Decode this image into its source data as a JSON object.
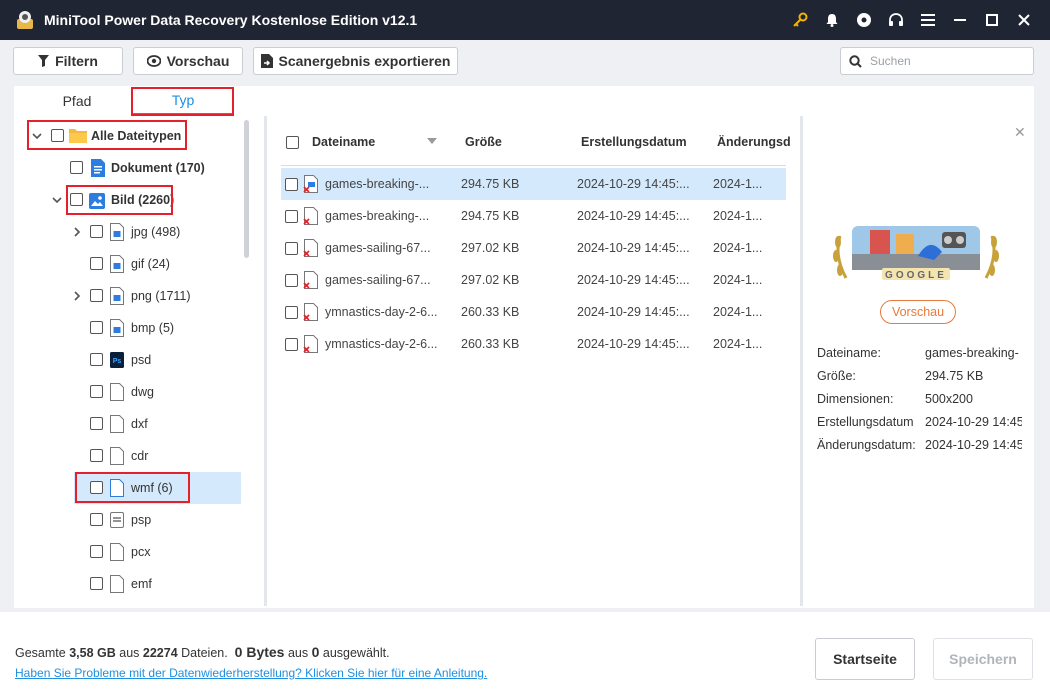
{
  "window": {
    "title": "MiniTool Power Data Recovery Kostenlose Edition v12.1"
  },
  "toolbar": {
    "filter_label": "Filtern",
    "preview_label": "Vorschau",
    "export_label": "Scanergebnis exportieren",
    "search_placeholder": "Suchen"
  },
  "tabs": {
    "path_label": "Pfad",
    "type_label": "Typ"
  },
  "tree": {
    "root_label": "Alle Dateitypen",
    "document_label": "Dokument (170)",
    "image_label": "Bild (2260)",
    "items": [
      {
        "label": "jpg (498)",
        "icon": "image-file-icon"
      },
      {
        "label": "gif (24)",
        "icon": "image-file-icon"
      },
      {
        "label": "png (1711)",
        "icon": "image-file-icon"
      },
      {
        "label": "bmp (5)",
        "icon": "image-file-icon"
      },
      {
        "label": "psd",
        "icon": "photoshop-file-icon"
      },
      {
        "label": "dwg",
        "icon": "blank-file-icon"
      },
      {
        "label": "dxf",
        "icon": "blank-file-icon"
      },
      {
        "label": "cdr",
        "icon": "blank-file-icon"
      },
      {
        "label": "wmf (6)",
        "icon": "blank-file-icon"
      },
      {
        "label": "psp",
        "icon": "psp-file-icon"
      },
      {
        "label": "pcx",
        "icon": "blank-file-icon"
      },
      {
        "label": "emf",
        "icon": "blank-file-icon"
      }
    ]
  },
  "file_list": {
    "headers": {
      "name": "Dateiname",
      "size": "Größe",
      "created": "Erstellungsdatum",
      "modified": "Änderungsd"
    },
    "rows": [
      {
        "name": "games-breaking-...",
        "size": "294.75 KB",
        "created": "2024-10-29 14:45:...",
        "modified": "2024-1..."
      },
      {
        "name": "games-breaking-...",
        "size": "294.75 KB",
        "created": "2024-10-29 14:45:...",
        "modified": "2024-1..."
      },
      {
        "name": "games-sailing-67...",
        "size": "297.02 KB",
        "created": "2024-10-29 14:45:...",
        "modified": "2024-1..."
      },
      {
        "name": "games-sailing-67...",
        "size": "297.02 KB",
        "created": "2024-10-29 14:45:...",
        "modified": "2024-1..."
      },
      {
        "name": "ymnastics-day-2-6...",
        "size": "260.33 KB",
        "created": "2024-10-29 14:45:...",
        "modified": "2024-1..."
      },
      {
        "name": "ymnastics-day-2-6...",
        "size": "260.33 KB",
        "created": "2024-10-29 14:45:...",
        "modified": "2024-1..."
      }
    ]
  },
  "preview": {
    "button_label": "Vorschau",
    "image_text": "GOOGLE",
    "info": {
      "name_label": "Dateiname:",
      "name_value": "games-breaking-",
      "size_label": "Größe:",
      "size_value": "294.75 KB",
      "dim_label": "Dimensionen:",
      "dim_value": "500x200",
      "created_label": "Erstellungsdatum",
      "created_value": "2024-10-29 14:45",
      "modified_label": "Änderungsdatum:",
      "modified_value": "2024-10-29 14:45"
    }
  },
  "footer": {
    "total_prefix": "Gesamte",
    "total_size": "3,58 GB",
    "total_mid": "aus",
    "total_files": "22274",
    "total_suffix": "Dateien.",
    "selected_size": "0 Bytes",
    "selected_mid": "aus",
    "selected_count": "0",
    "selected_suffix": "ausgewählt.",
    "help_link": "Haben Sie Probleme mit der Datenwiederherstellung? Klicken Sie hier für eine Anleitung.",
    "home_button": "Startseite",
    "save_button": "Speichern"
  },
  "colors": {
    "titlebar": "#1f2533",
    "accent": "#1e8fe1",
    "highlight_box": "#e5202a",
    "preview_button": "#e8793a",
    "selected_row": "#d4e9fb"
  }
}
